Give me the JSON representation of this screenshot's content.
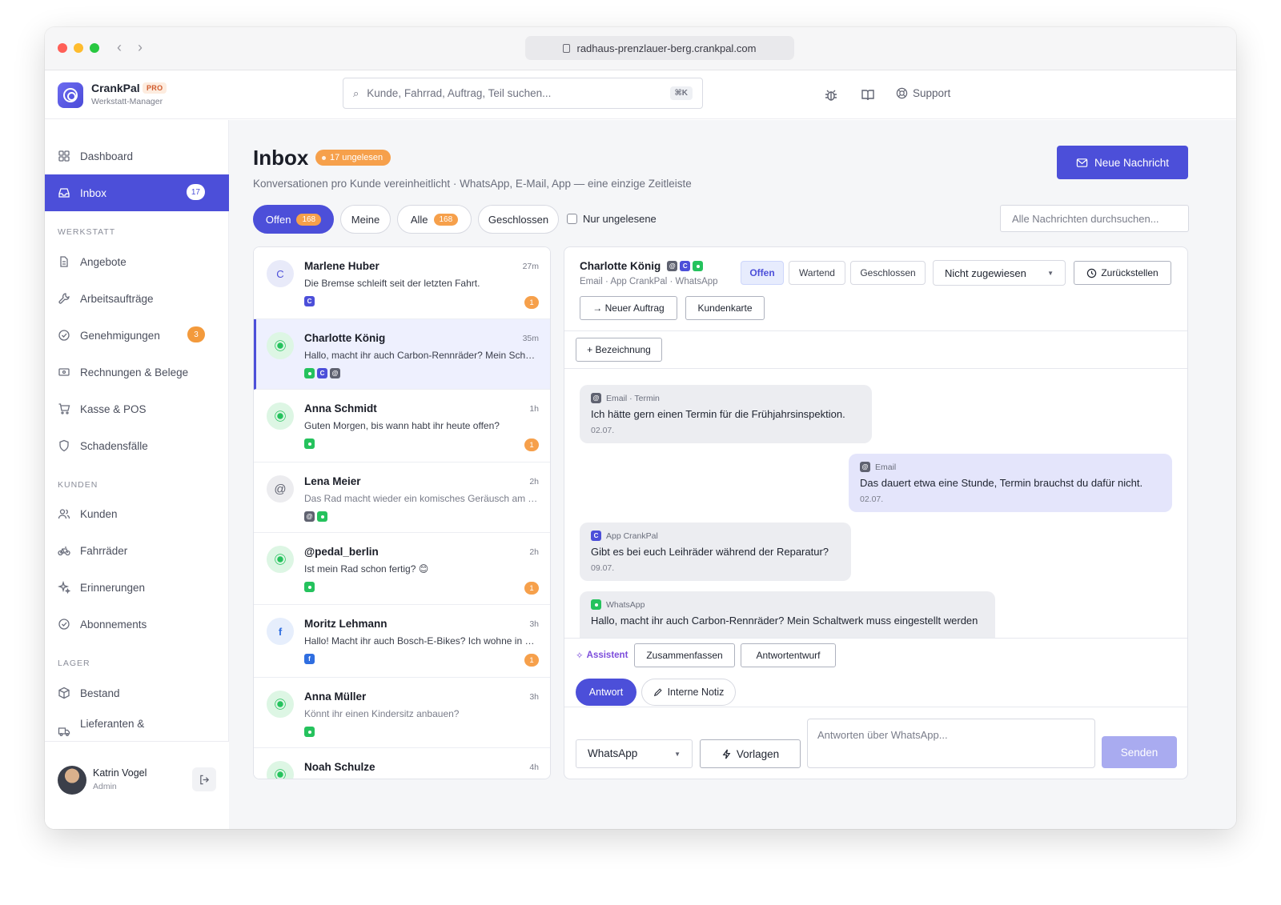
{
  "browser": {
    "url": "radhaus-prenzlauer-berg.crankpal.com"
  },
  "app": {
    "name": "CrankPal",
    "tier": "PRO",
    "subtitle": "Werkstatt-Manager"
  },
  "search": {
    "placeholder": "Kunde, Fahrrad, Auftrag, Teil suchen...",
    "shortcut": "⌘K"
  },
  "header": {
    "support_label": "Support"
  },
  "sidebar": {
    "top": [
      {
        "label": "Dashboard",
        "icon": "grid-icon"
      },
      {
        "label": "Inbox",
        "icon": "inbox-icon",
        "badge": "17",
        "active": true
      }
    ],
    "sections": [
      {
        "title": "WERKSTATT",
        "items": [
          {
            "label": "Angebote",
            "icon": "document-icon"
          },
          {
            "label": "Arbeitsaufträge",
            "icon": "wrench-icon"
          },
          {
            "label": "Genehmigungen",
            "icon": "check-circle-icon",
            "badge": "3"
          },
          {
            "label": "Rechnungen & Belege",
            "icon": "receipt-icon"
          },
          {
            "label": "Kasse & POS",
            "icon": "cart-icon"
          },
          {
            "label": "Schadensfälle",
            "icon": "shield-icon"
          }
        ]
      },
      {
        "title": "KUNDEN",
        "items": [
          {
            "label": "Kunden",
            "icon": "users-icon"
          },
          {
            "label": "Fahrräder",
            "icon": "bike-icon"
          },
          {
            "label": "Erinnerungen",
            "icon": "sparkle-icon"
          },
          {
            "label": "Abonnements",
            "icon": "check-circle-icon"
          }
        ]
      },
      {
        "title": "LAGER",
        "items": [
          {
            "label": "Bestand",
            "icon": "box-icon"
          },
          {
            "label": "Lieferanten &",
            "icon": "truck-icon"
          }
        ]
      }
    ],
    "user": {
      "name": "Katrin Vogel",
      "role": "Admin"
    }
  },
  "inbox": {
    "title": "Inbox",
    "unread_label": "17 ungelesen",
    "subtitle": "Konversationen pro Kunde vereinheitlicht · WhatsApp, E-Mail, App — eine einzige Zeitleiste",
    "new_message_label": "Neue Nachricht",
    "filters": [
      {
        "label": "Offen",
        "count": "168",
        "active": true
      },
      {
        "label": "Meine"
      },
      {
        "label": "Alle",
        "count": "168"
      },
      {
        "label": "Geschlossen"
      }
    ],
    "unread_only_label": "Nur ungelesene",
    "search_all_placeholder": "Alle Nachrichten durchsuchen...",
    "conversations": [
      {
        "name": "Marlene Huber",
        "time": "27m",
        "preview": "Die Bremse schleift seit der letzten Fahrt.",
        "avatar": "C",
        "avatar_type": "letter",
        "channels": [
          "c"
        ],
        "unread": "1"
      },
      {
        "name": "Charlotte König",
        "time": "35m",
        "preview": "Hallo, macht ihr auch Carbon-Rennräder? Mein Schaltwerk muss eingestellt werden",
        "avatar": "",
        "avatar_type": "wa",
        "channels": [
          "wa",
          "c",
          "at"
        ],
        "unread": "",
        "selected": true
      },
      {
        "name": "Anna Schmidt",
        "time": "1h",
        "preview": "Guten Morgen, bis wann habt ihr heute offen?",
        "avatar": "",
        "avatar_type": "wa",
        "channels": [
          "wa"
        ],
        "unread": "1"
      },
      {
        "name": "Lena Meier",
        "time": "2h",
        "preview": "Das Rad macht wieder ein komisches Geräusch am Tretlager",
        "avatar": "@",
        "avatar_type": "at",
        "channels": [
          "at",
          "wa"
        ],
        "unread": ""
      },
      {
        "name": "@pedal_berlin",
        "time": "2h",
        "preview": "Ist mein Rad schon fertig? 😊",
        "avatar": "",
        "avatar_type": "wa",
        "channels": [
          "wa"
        ],
        "unread": "1"
      },
      {
        "name": "Moritz Lehmann",
        "time": "3h",
        "preview": "Hallo! Macht ihr auch Bosch-E-Bikes? Ich wohne in der Nähe",
        "avatar": "f",
        "avatar_type": "fb",
        "channels": [
          "f"
        ],
        "unread": "1"
      },
      {
        "name": "Anna Müller",
        "time": "3h",
        "preview": "Könnt ihr einen Kindersitz anbauen?",
        "avatar": "",
        "avatar_type": "wa",
        "channels": [
          "wa"
        ],
        "unread": ""
      },
      {
        "name": "Noah Schulze",
        "time": "4h",
        "preview": "",
        "avatar": "",
        "avatar_type": "wa",
        "channels": [],
        "unread": ""
      }
    ]
  },
  "detail": {
    "name": "Charlotte König",
    "channels_line": "Email · App CrankPal · WhatsApp",
    "status_buttons": [
      "Offen",
      "Wartend",
      "Geschlossen"
    ],
    "assignee": "Nicht zugewiesen",
    "snooze_label": "Zurückstellen",
    "new_order_label": "→ Neuer Auftrag",
    "customer_card_label": "Kundenkarte",
    "add_label_label": "+ Bezeichnung",
    "messages": [
      {
        "meta": "Email · Termin",
        "channel": "at",
        "text": "Ich hätte gern einen Termin für die Frühjahrsinspektion.",
        "date": "02.07.",
        "direction": "in"
      },
      {
        "meta": "Email",
        "channel": "at",
        "text": "Das dauert etwa eine Stunde, Termin brauchst du dafür nicht.",
        "date": "02.07.",
        "direction": "out"
      },
      {
        "meta": "App CrankPal",
        "channel": "c",
        "text": "Gibt es bei euch Leihräder während der Reparatur?",
        "date": "09.07.",
        "direction": "in"
      },
      {
        "meta": "WhatsApp",
        "channel": "wa",
        "text": "Hallo, macht ihr auch Carbon-Rennräder? Mein Schaltwerk muss eingestellt werden",
        "date": "",
        "direction": "in"
      }
    ],
    "assistant_label": "Assistent",
    "summarize_label": "Zusammenfassen",
    "draft_label": "Antwortentwurf",
    "tab_reply": "Antwort",
    "tab_note": "Interne Notiz",
    "channel_select": "WhatsApp",
    "templates_label": "Vorlagen",
    "reply_placeholder": "Antworten über WhatsApp...",
    "send_label": "Senden"
  }
}
